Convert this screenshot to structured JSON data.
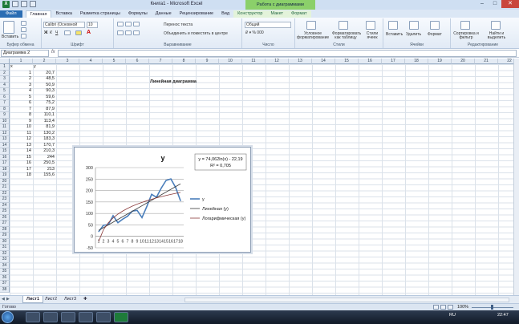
{
  "window": {
    "title": "Книга1 - Microsoft Excel",
    "context_title": "Работа с диаграммами"
  },
  "tabs": [
    {
      "label": "Файл",
      "kind": "file"
    },
    {
      "label": "Главная",
      "kind": "active"
    },
    {
      "label": "Вставка",
      "kind": ""
    },
    {
      "label": "Разметка страницы",
      "kind": ""
    },
    {
      "label": "Формулы",
      "kind": ""
    },
    {
      "label": "Данные",
      "kind": ""
    },
    {
      "label": "Рецензирование",
      "kind": ""
    },
    {
      "label": "Вид",
      "kind": ""
    },
    {
      "label": "Конструктор",
      "kind": "ctx"
    },
    {
      "label": "Макет",
      "kind": "ctx"
    },
    {
      "label": "Формат",
      "kind": "ctx"
    }
  ],
  "ribbon": {
    "paste": "Вставить",
    "font_name": "Calibri (Основной",
    "font_size": "10",
    "wrap_text": "Перенос текста",
    "merge": "Объединить и поместить в центре",
    "number_format": "Общий",
    "cond_format": "Условное форматирование",
    "format_table": "Форматировать как таблицу",
    "cell_styles": "Стили ячеек",
    "insert": "Вставить",
    "delete": "Удалить",
    "format": "Формат",
    "sort": "Сортировка и фильтр",
    "find": "Найти и выделить",
    "groups": {
      "clipboard": "Буфер обмена",
      "font": "Шрифт",
      "alignment": "Выравнивание",
      "number": "Число",
      "styles": "Стили",
      "cells": "Ячейки",
      "editing": "Редактирование"
    }
  },
  "formula_bar": {
    "name_box": "Диаграмма 2",
    "fx": "fx",
    "value": ""
  },
  "columns": [
    "1",
    "2",
    "3",
    "4",
    "5",
    "6",
    "7",
    "8",
    "9",
    "10",
    "11",
    "12",
    "13",
    "14",
    "15",
    "16",
    "17",
    "18",
    "19",
    "20",
    "21",
    "22"
  ],
  "rows": [
    "1",
    "2",
    "3",
    "4",
    "5",
    "6",
    "7",
    "8",
    "9",
    "10",
    "11",
    "12",
    "13",
    "14",
    "15",
    "16",
    "17",
    "18",
    "19",
    "20",
    "21",
    "22",
    "23",
    "24",
    "25",
    "26",
    "27",
    "28",
    "29",
    "30",
    "31",
    "32",
    "33",
    "34",
    "35",
    "36",
    "37",
    "38"
  ],
  "sheet": {
    "heading_x": "x",
    "heading_y": "y",
    "title_cell": "Линейная диаграмма",
    "rows": [
      {
        "x": "1",
        "y": "20,7"
      },
      {
        "x": "2",
        "y": "48,5"
      },
      {
        "x": "3",
        "y": "50,9"
      },
      {
        "x": "4",
        "y": "90,3"
      },
      {
        "x": "5",
        "y": "59,6"
      },
      {
        "x": "6",
        "y": "75,2"
      },
      {
        "x": "7",
        "y": "87,9"
      },
      {
        "x": "8",
        "y": "110,1"
      },
      {
        "x": "9",
        "y": "113,4"
      },
      {
        "x": "10",
        "y": "81,9"
      },
      {
        "x": "11",
        "y": "130,2"
      },
      {
        "x": "12",
        "y": "183,3"
      },
      {
        "x": "13",
        "y": "170,7"
      },
      {
        "x": "14",
        "y": "210,3"
      },
      {
        "x": "15",
        "y": "244"
      },
      {
        "x": "16",
        "y": "250,5"
      },
      {
        "x": "17",
        "y": "213"
      },
      {
        "x": "18",
        "y": "155,6"
      }
    ]
  },
  "chart_data": {
    "type": "line",
    "title": "y",
    "categories": [
      "1",
      "2",
      "3",
      "4",
      "5",
      "6",
      "7",
      "8",
      "9",
      "10",
      "11",
      "12",
      "13",
      "14",
      "15",
      "16",
      "17",
      "18"
    ],
    "series": [
      {
        "name": "y",
        "values": [
          20.7,
          48.5,
          50.9,
          90.3,
          59.6,
          75.2,
          87.9,
          110.1,
          113.4,
          81.9,
          130.2,
          183.3,
          170.7,
          210.3,
          244,
          250.5,
          213,
          155.6
        ]
      }
    ],
    "trendlines": [
      {
        "name": "Линейная (y)",
        "type": "linear"
      },
      {
        "name": "Логарифмическая (y)",
        "type": "logarithmic",
        "a": 74.062,
        "b": -22.19
      }
    ],
    "equation": "y = 74,062ln(x) - 22,19",
    "r2": "R² = 0,705",
    "ylim": [
      -50,
      300
    ],
    "yticks": [
      "300",
      "250",
      "200",
      "150",
      "100",
      "50",
      "0",
      "-50"
    ],
    "grid": true,
    "legend_position": "right",
    "colors": {
      "series": "#4a7ebb",
      "linear": "#3a3a3a",
      "log": "#8a3a3a"
    }
  },
  "sheets": [
    "Лист1",
    "Лист2",
    "Лист3"
  ],
  "status": {
    "ready": "Готово",
    "zoom": "100%"
  },
  "taskbar": {
    "lang": "RU",
    "time": "22:47"
  }
}
